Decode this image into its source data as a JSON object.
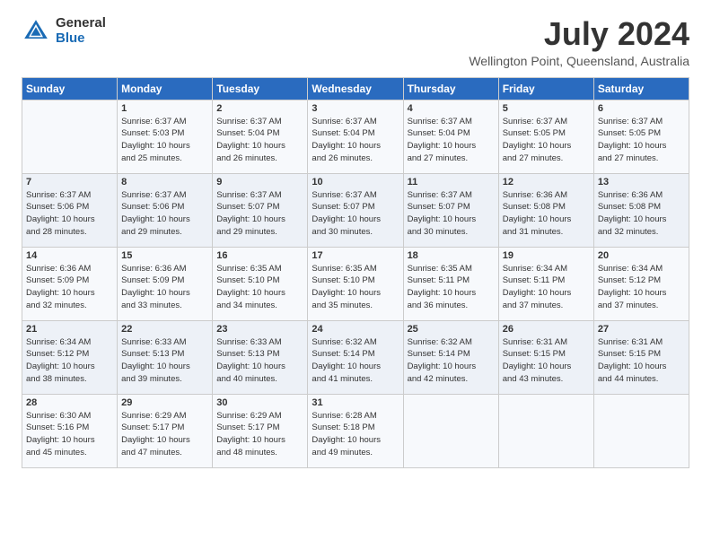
{
  "header": {
    "logo_general": "General",
    "logo_blue": "Blue",
    "month_title": "July 2024",
    "location": "Wellington Point, Queensland, Australia"
  },
  "calendar": {
    "days_of_week": [
      "Sunday",
      "Monday",
      "Tuesday",
      "Wednesday",
      "Thursday",
      "Friday",
      "Saturday"
    ],
    "weeks": [
      [
        {
          "day": "",
          "info": ""
        },
        {
          "day": "1",
          "info": "Sunrise: 6:37 AM\nSunset: 5:03 PM\nDaylight: 10 hours\nand 25 minutes."
        },
        {
          "day": "2",
          "info": "Sunrise: 6:37 AM\nSunset: 5:04 PM\nDaylight: 10 hours\nand 26 minutes."
        },
        {
          "day": "3",
          "info": "Sunrise: 6:37 AM\nSunset: 5:04 PM\nDaylight: 10 hours\nand 26 minutes."
        },
        {
          "day": "4",
          "info": "Sunrise: 6:37 AM\nSunset: 5:04 PM\nDaylight: 10 hours\nand 27 minutes."
        },
        {
          "day": "5",
          "info": "Sunrise: 6:37 AM\nSunset: 5:05 PM\nDaylight: 10 hours\nand 27 minutes."
        },
        {
          "day": "6",
          "info": "Sunrise: 6:37 AM\nSunset: 5:05 PM\nDaylight: 10 hours\nand 27 minutes."
        }
      ],
      [
        {
          "day": "7",
          "info": "Sunrise: 6:37 AM\nSunset: 5:06 PM\nDaylight: 10 hours\nand 28 minutes."
        },
        {
          "day": "8",
          "info": "Sunrise: 6:37 AM\nSunset: 5:06 PM\nDaylight: 10 hours\nand 29 minutes."
        },
        {
          "day": "9",
          "info": "Sunrise: 6:37 AM\nSunset: 5:07 PM\nDaylight: 10 hours\nand 29 minutes."
        },
        {
          "day": "10",
          "info": "Sunrise: 6:37 AM\nSunset: 5:07 PM\nDaylight: 10 hours\nand 30 minutes."
        },
        {
          "day": "11",
          "info": "Sunrise: 6:37 AM\nSunset: 5:07 PM\nDaylight: 10 hours\nand 30 minutes."
        },
        {
          "day": "12",
          "info": "Sunrise: 6:36 AM\nSunset: 5:08 PM\nDaylight: 10 hours\nand 31 minutes."
        },
        {
          "day": "13",
          "info": "Sunrise: 6:36 AM\nSunset: 5:08 PM\nDaylight: 10 hours\nand 32 minutes."
        }
      ],
      [
        {
          "day": "14",
          "info": "Sunrise: 6:36 AM\nSunset: 5:09 PM\nDaylight: 10 hours\nand 32 minutes."
        },
        {
          "day": "15",
          "info": "Sunrise: 6:36 AM\nSunset: 5:09 PM\nDaylight: 10 hours\nand 33 minutes."
        },
        {
          "day": "16",
          "info": "Sunrise: 6:35 AM\nSunset: 5:10 PM\nDaylight: 10 hours\nand 34 minutes."
        },
        {
          "day": "17",
          "info": "Sunrise: 6:35 AM\nSunset: 5:10 PM\nDaylight: 10 hours\nand 35 minutes."
        },
        {
          "day": "18",
          "info": "Sunrise: 6:35 AM\nSunset: 5:11 PM\nDaylight: 10 hours\nand 36 minutes."
        },
        {
          "day": "19",
          "info": "Sunrise: 6:34 AM\nSunset: 5:11 PM\nDaylight: 10 hours\nand 37 minutes."
        },
        {
          "day": "20",
          "info": "Sunrise: 6:34 AM\nSunset: 5:12 PM\nDaylight: 10 hours\nand 37 minutes."
        }
      ],
      [
        {
          "day": "21",
          "info": "Sunrise: 6:34 AM\nSunset: 5:12 PM\nDaylight: 10 hours\nand 38 minutes."
        },
        {
          "day": "22",
          "info": "Sunrise: 6:33 AM\nSunset: 5:13 PM\nDaylight: 10 hours\nand 39 minutes."
        },
        {
          "day": "23",
          "info": "Sunrise: 6:33 AM\nSunset: 5:13 PM\nDaylight: 10 hours\nand 40 minutes."
        },
        {
          "day": "24",
          "info": "Sunrise: 6:32 AM\nSunset: 5:14 PM\nDaylight: 10 hours\nand 41 minutes."
        },
        {
          "day": "25",
          "info": "Sunrise: 6:32 AM\nSunset: 5:14 PM\nDaylight: 10 hours\nand 42 minutes."
        },
        {
          "day": "26",
          "info": "Sunrise: 6:31 AM\nSunset: 5:15 PM\nDaylight: 10 hours\nand 43 minutes."
        },
        {
          "day": "27",
          "info": "Sunrise: 6:31 AM\nSunset: 5:15 PM\nDaylight: 10 hours\nand 44 minutes."
        }
      ],
      [
        {
          "day": "28",
          "info": "Sunrise: 6:30 AM\nSunset: 5:16 PM\nDaylight: 10 hours\nand 45 minutes."
        },
        {
          "day": "29",
          "info": "Sunrise: 6:29 AM\nSunset: 5:17 PM\nDaylight: 10 hours\nand 47 minutes."
        },
        {
          "day": "30",
          "info": "Sunrise: 6:29 AM\nSunset: 5:17 PM\nDaylight: 10 hours\nand 48 minutes."
        },
        {
          "day": "31",
          "info": "Sunrise: 6:28 AM\nSunset: 5:18 PM\nDaylight: 10 hours\nand 49 minutes."
        },
        {
          "day": "",
          "info": ""
        },
        {
          "day": "",
          "info": ""
        },
        {
          "day": "",
          "info": ""
        }
      ]
    ]
  }
}
